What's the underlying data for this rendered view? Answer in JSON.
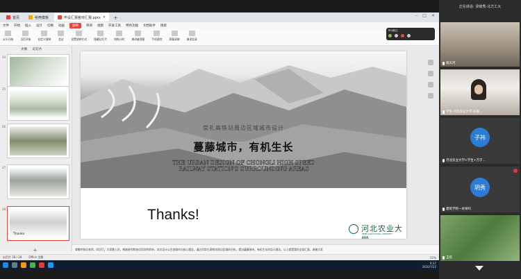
{
  "wps": {
    "tabs": [
      {
        "label": "首页",
        "color": "#e7433b"
      },
      {
        "label": "稻壳模板",
        "color": "#f7a400"
      },
      {
        "label": "毕设汇报答辩汇报.pptx",
        "color": "#e7433b"
      }
    ],
    "menu": [
      "文件",
      "开始",
      "插入",
      "设计",
      "切换",
      "动画",
      "放映",
      "审阅",
      "视图",
      "开发工具",
      "特色功能",
      "文档助手",
      "搜索"
    ],
    "menu_active": "放映",
    "ribbon": [
      "从头开始",
      "当页开始",
      "自定义放映",
      "会议",
      "设置放映方式",
      "隐藏幻灯片",
      "排练计时",
      "演讲者视图",
      "手机遥控",
      "屏幕录制",
      "演讲实录"
    ],
    "thumb_head": [
      "大纲",
      "幻灯片"
    ],
    "thumb_numbers": [
      "24",
      "25",
      "26",
      "27",
      "28"
    ],
    "thumb_last_text": "Thanks",
    "notes_text": "尊敬的各位老师，同学们，大家晚上好，感谢老师和各位同学的聆听，本次设计以生态城市为核心理念，通过对崇礼高铁站周边区域的分析，提出蔓藤城市，有机生长的设计理念，以上就是我的全部汇报，谢谢大家",
    "status": {
      "slide": "幻灯片 28 / 28",
      "theme": "Office 主题",
      "zoom": "51%"
    }
  },
  "meeting_bar": {
    "title": "阿Q触达"
  },
  "slide": {
    "subtitle_cn": "崇礼高铁站周边区域城市设计",
    "title_cn": "蔓藤城市，有机生长",
    "title_en": "THE URBAN DESIGN OF CHONGLI HIGH SPEED RAILWAY STATION'S SURROUNDING AREAS",
    "thanks": "Thanks!",
    "logo_cn": "河北农业大学",
    "logo_en": "HEBEI AGRICULTURAL UNIVERSITY"
  },
  "taskbar": {
    "time": "9:37",
    "date": "2020/7/22"
  },
  "participants_panel": {
    "speaking_prefix": "正在讲话:",
    "speaking_name": "梁筱秀-北方工大",
    "tiles": [
      {
        "label": "蒋天河",
        "kind": "video"
      },
      {
        "label": "学生-河北农业大学-赵嘉...",
        "kind": "video"
      },
      {
        "label": "河北农业大学+学生+万子...",
        "kind": "avatar",
        "avatar_text": "子祎",
        "avatar_color": "#2b7cd3"
      },
      {
        "label": "建筑学院一呆呆吗",
        "kind": "avatar",
        "avatar_text": "玥秀",
        "avatar_color": "#2b7cd3"
      },
      {
        "label": "王欢",
        "kind": "video"
      }
    ]
  }
}
